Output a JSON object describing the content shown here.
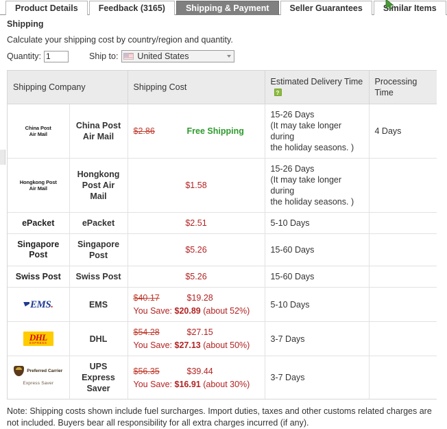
{
  "tabs": [
    {
      "label": "Product Details",
      "active": false
    },
    {
      "label": "Feedback (3165)",
      "active": false
    },
    {
      "label": "Shipping & Payment",
      "active": true
    },
    {
      "label": "Seller Guarantees",
      "active": false
    },
    {
      "label": "Similar Items",
      "active": false
    }
  ],
  "shipping": {
    "title": "Shipping",
    "calc_text": "Calculate your shipping cost by country/region and quantity.",
    "quantity_label": "Quantity:",
    "quantity_value": "1",
    "shipto_label": "Ship to:",
    "shipto_value": "United States",
    "flag_icon": "us-flag-icon"
  },
  "table": {
    "headers": {
      "company": "Shipping Company",
      "cost": "Shipping Cost",
      "eta": "Estimated Delivery Time",
      "eta_help_icon": "?",
      "processing": "Processing Time"
    },
    "rows": [
      {
        "logo_type": "text2",
        "logo_line1": "China Post",
        "logo_line2": "Air Mail",
        "name": "China Post Air Mail",
        "old_price": "$2.86",
        "new_price": "",
        "free_shipping": "Free Shipping",
        "you_save": "",
        "eta_main": "15-26 Days",
        "eta_note1": "(It may take longer during",
        "eta_note2": "the holiday seasons. )",
        "processing": "4 Days"
      },
      {
        "logo_type": "text2",
        "logo_line1": "Hongkong Post",
        "logo_line2": "Air Mail",
        "name": "Hongkong Post Air Mail",
        "old_price": "",
        "new_price": "$1.58",
        "free_shipping": "",
        "you_save": "",
        "eta_main": "15-26 Days",
        "eta_note1": "(It may take longer during",
        "eta_note2": "the holiday seasons. )",
        "processing": ""
      },
      {
        "logo_type": "plain",
        "logo_line1": "ePacket",
        "logo_line2": "",
        "name": "ePacket",
        "old_price": "",
        "new_price": "$2.51",
        "free_shipping": "",
        "you_save": "",
        "eta_main": "5-10 Days",
        "eta_note1": "",
        "eta_note2": "",
        "processing": ""
      },
      {
        "logo_type": "plain2",
        "logo_line1": "Singapore",
        "logo_line2": "Post",
        "name": "Singapore Post",
        "old_price": "",
        "new_price": "$5.26",
        "free_shipping": "",
        "you_save": "",
        "eta_main": "15-60 Days",
        "eta_note1": "",
        "eta_note2": "",
        "processing": ""
      },
      {
        "logo_type": "plain",
        "logo_line1": "Swiss Post",
        "logo_line2": "",
        "name": "Swiss Post",
        "old_price": "",
        "new_price": "$5.26",
        "free_shipping": "",
        "you_save": "",
        "eta_main": "15-60 Days",
        "eta_note1": "",
        "eta_note2": "",
        "processing": ""
      },
      {
        "logo_type": "ems",
        "logo_line1": "EMS",
        "logo_line2": "",
        "name": "EMS",
        "old_price": "$40.17",
        "new_price": "$19.28",
        "free_shipping": "",
        "you_save_prefix": "You Save: ",
        "you_save_amount": "$20.89",
        "you_save_pct": " (about 52%)",
        "eta_main": "5-10 Days",
        "eta_note1": "",
        "eta_note2": "",
        "processing": ""
      },
      {
        "logo_type": "dhl",
        "logo_line1": "DHL",
        "logo_line2": "EXPRESS",
        "name": "DHL",
        "old_price": "$54.28",
        "new_price": "$27.15",
        "free_shipping": "",
        "you_save_prefix": "You Save: ",
        "you_save_amount": "$27.13",
        "you_save_pct": " (about 50%)",
        "eta_main": "3-7 Days",
        "eta_note1": "",
        "eta_note2": "",
        "processing": ""
      },
      {
        "logo_type": "ups",
        "logo_line1": "Preferred Carrier",
        "logo_line2": "Express Saver",
        "name": "UPS Express Saver",
        "old_price": "$56.35",
        "new_price": "$39.44",
        "free_shipping": "",
        "you_save_prefix": "You Save: ",
        "you_save_amount": "$16.91",
        "you_save_pct": " (about 30%)",
        "eta_main": "3-7 Days",
        "eta_note1": "",
        "eta_note2": "",
        "processing": ""
      }
    ]
  },
  "note": {
    "line1": "Note: Shipping costs shown include fuel surcharges. Import duties, taxes and other customs related charges are",
    "line2": "not included. Buyers bear all responsibility for all extra charges incurred (if any)."
  },
  "colors": {
    "price_red": "#b22222",
    "free_green": "#2d9b2d",
    "active_tab_bg": "#808080",
    "header_bg": "#ebebeb"
  }
}
